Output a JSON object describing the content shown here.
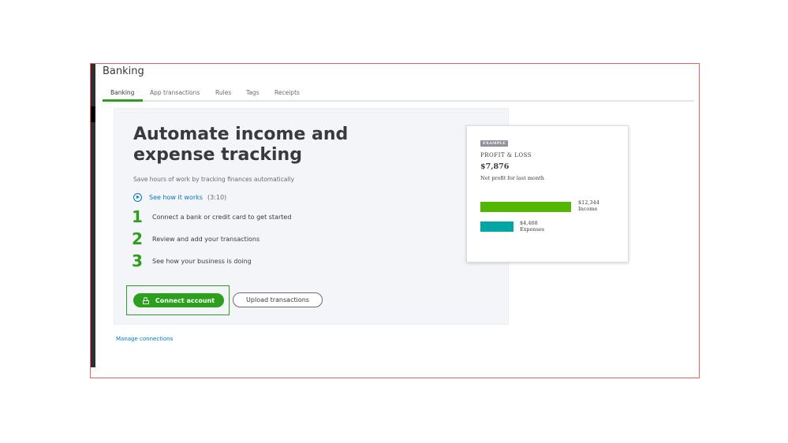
{
  "page": {
    "title": "Banking"
  },
  "tabs": [
    {
      "label": "Banking",
      "active": true
    },
    {
      "label": "App transactions",
      "active": false
    },
    {
      "label": "Rules",
      "active": false
    },
    {
      "label": "Tags",
      "active": false
    },
    {
      "label": "Receipts",
      "active": false
    }
  ],
  "hero": {
    "title_line1": "Automate income and",
    "title_line2": "expense tracking",
    "subtitle": "Save hours of work by tracking finances automatically"
  },
  "video": {
    "label": "See how it works",
    "duration": "(3:10)",
    "icon": "play-circle-icon"
  },
  "steps": [
    {
      "number": "1",
      "text": "Connect a bank or credit card to get started"
    },
    {
      "number": "2",
      "text": "Review and add your transactions"
    },
    {
      "number": "3",
      "text": "See how your business is doing"
    }
  ],
  "buttons": {
    "connect": "Connect account",
    "connect_icon": "lock-icon",
    "upload": "Upload transactions"
  },
  "links": {
    "manage": "Manage connections"
  },
  "example_card": {
    "badge": "EXAMPLE",
    "title": "PROFIT & LOSS",
    "amount": "$7,876",
    "caption": "Net profit for last month",
    "income": {
      "value": "$12,344",
      "label": "Income",
      "amount": 12344,
      "color": "#53b700"
    },
    "expenses": {
      "value": "$4,468",
      "label": "Expenses",
      "amount": 4468,
      "color": "#00a6a4"
    }
  },
  "colors": {
    "brand_green": "#2ca01c",
    "link_blue": "#0077c5",
    "frame_red": "#e8625e"
  }
}
